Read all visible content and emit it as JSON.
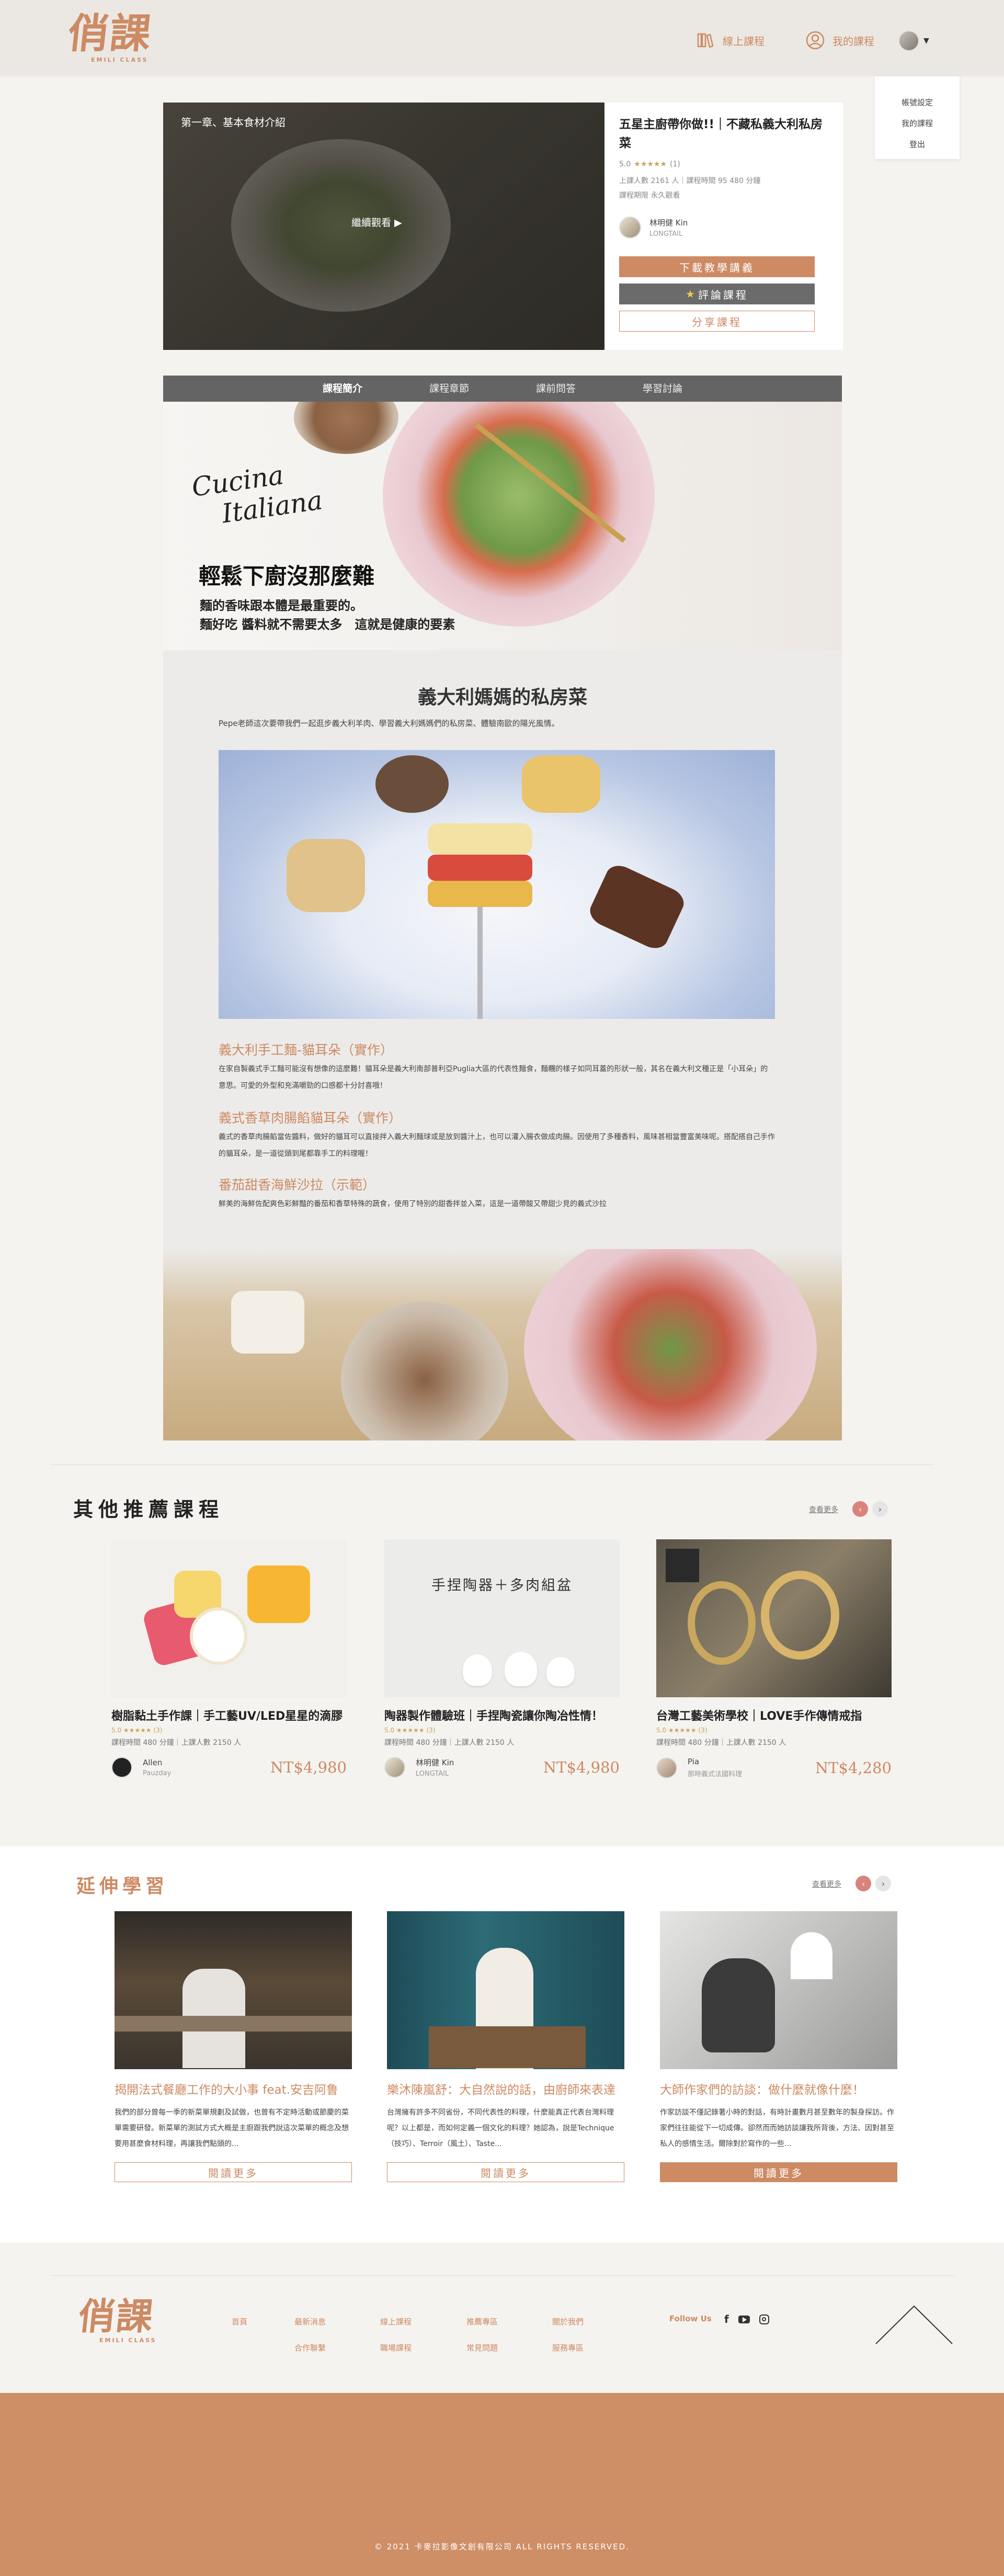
{
  "header": {
    "logo_text": "俏課",
    "logo_sub": "EMILI CLASS",
    "nav_online": "線上課程",
    "nav_my_course": "我的課程",
    "dropdown": [
      "帳號設定",
      "我的課程",
      "登出"
    ]
  },
  "hero": {
    "video_chapter": "第一章、基本食材介紹",
    "play_label": "繼續觀看 ▶",
    "course_title": "五星主廚帶你做!!｜不藏私義大利私房菜",
    "rating_stars": "★★★★★",
    "rating_value": "5.0",
    "rating_count": "(1)",
    "meta_line1": "上課人數 2161 人｜課程時間 95 480 分鐘",
    "meta_line2": "課程期限 永久觀看",
    "teacher_name": "林明健 Kin",
    "teacher_sub": "LONGTAIL",
    "btn_download": "下載教學講義",
    "btn_review": "評論課程",
    "btn_share": "分享課程"
  },
  "tabs": [
    "課程簡介",
    "課程章節",
    "課前問答",
    "學習討論"
  ],
  "article": {
    "banner_script": "Cucina\nItaliana",
    "banner_heading": "輕鬆下廚沒那麼難",
    "banner_text1": "麵的香味跟本體是最重要的。",
    "banner_text2": "麵好吃 醬料就不需要太多　這就是健康的要素",
    "section_title": "義大利媽媽的私房菜",
    "section_intro": "Pepe老師這次要帶我們一起逛步義大利羊肉、學習義大利媽媽們的私房菜、體驗南歐的陽光風情。",
    "dishes": [
      {
        "title": "義大利手工麵-貓耳朵（實作）",
        "desc": "在家自製義式手工麵可能沒有想像的這麼難！貓耳朵是義大利南部普利亞Puglia大區的代表性麵食，麵糰的樣子如同耳蓋的形狀一般，其名在義大利文種正是「小耳朵」的意思。可愛的外型和充滿嚼勁的口感都十分討喜哦！"
      },
      {
        "title": "義式香草肉腸餡貓耳朵（實作）",
        "desc": "義式的香草肉腸餡當佐醬料，做好的貓耳可以直接拌入義大利麵球或是放到醬汁上，也可以灌入腸衣做成肉腸。因使用了多種香料，風味甚相當豐富美味呢。搭配搭自己手作的貓耳朵，是一道從頭到尾都靠手工的料理喔！"
      },
      {
        "title": "番茄甜香海鮮沙拉（示範）",
        "desc": "鮮美的海鮮佐配爽色彩鮮豔的番茄和香草特殊的蔬食，使用了特別的甜香拌並入菜，這是一道帶酸又帶甜少見的義式沙拉"
      }
    ]
  },
  "recommended": {
    "title": "其他推薦課程",
    "more": "查看更多",
    "cards": [
      {
        "title": "樹脂黏土手作課｜手工藝UV/LED星星的滴膠",
        "stars": "5.0 ★★★★★ (3)",
        "meta": "課程時間 480 分鐘｜上課人數 2150 人",
        "teacher": "Allen",
        "teacher_sub": "Pauzday",
        "price": "NT$4,980",
        "img_text": ""
      },
      {
        "title": "陶器製作體驗班｜手捏陶瓷讓你陶冶性情！",
        "stars": "5.0 ★★★★★ (3)",
        "meta": "課程時間 480 分鐘｜上課人數 2150 人",
        "teacher": "林明健 Kin",
        "teacher_sub": "LONGTAIL",
        "price": "NT$4,980",
        "img_text": "手捏陶器＋多肉組盆"
      },
      {
        "title": "台灣工藝美術學校｜LOVE手作傳情戒指",
        "stars": "5.0 ★★★★★ (3)",
        "meta": "課程時間 480 分鐘｜上課人數 2150 人",
        "teacher": "Pia",
        "teacher_sub": "那時義式法國料理",
        "price": "NT$4,280",
        "img_text": ""
      }
    ]
  },
  "extended": {
    "title": "延伸學習",
    "more": "查看更多",
    "cards": [
      {
        "title": "揭開法式餐廳工作的大小事 feat.安吉阿鲁",
        "desc": "我們的部分曾每一季的新菜單規劃及試做，也曾有不定時活動或節慶的菜單需要研發。新菜單的測試方式大概是主廚跟我們說這次菜單的概念及想要用甚麼食材料理，再讓我們點頭的...",
        "btn": "閱讀更多"
      },
      {
        "title": "樂沐陳嵐舒：大自然說的話，由廚師來表達",
        "desc": "台灣擁有許多不同省份，不同代表性的料理，什麼能真正代表台灣料理呢？以上都是，而如何定義一個文化的料理？她認為，說是Technique（技巧）、Terroir（風土）、Taste...",
        "btn": "閱讀更多"
      },
      {
        "title": "大師作家們的訪談：做什麼就像什麼！",
        "desc": "作家訪談不僅記錄著小時的對話，有時計畫數月甚至數年的製身探訪。作家們往往能從下一切成傳。卻然而而她訪談讓我所背後，方法、因對甚至私人的感情生活。爾除對於寫作的一些...",
        "btn": "閱讀更多"
      }
    ]
  },
  "footer": {
    "logo_text": "俏課",
    "logo_sub": "EMILI CLASS",
    "links": [
      "首頁",
      "最新消息",
      "線上課程",
      "推薦專區",
      "關於我們",
      "合作聯繫",
      "職場課程",
      "常見問題",
      "服務專區"
    ],
    "follow": "Follow Us",
    "copyright": "© 2021 卡麥拉影像文創有限公司 ALL RIGHTS RESERVED."
  },
  "colors": {
    "accent": "#cd8a63",
    "header_bg": "#ebe8e3",
    "tab_bg": "#646464",
    "footer_bg": "#ce8e66"
  }
}
